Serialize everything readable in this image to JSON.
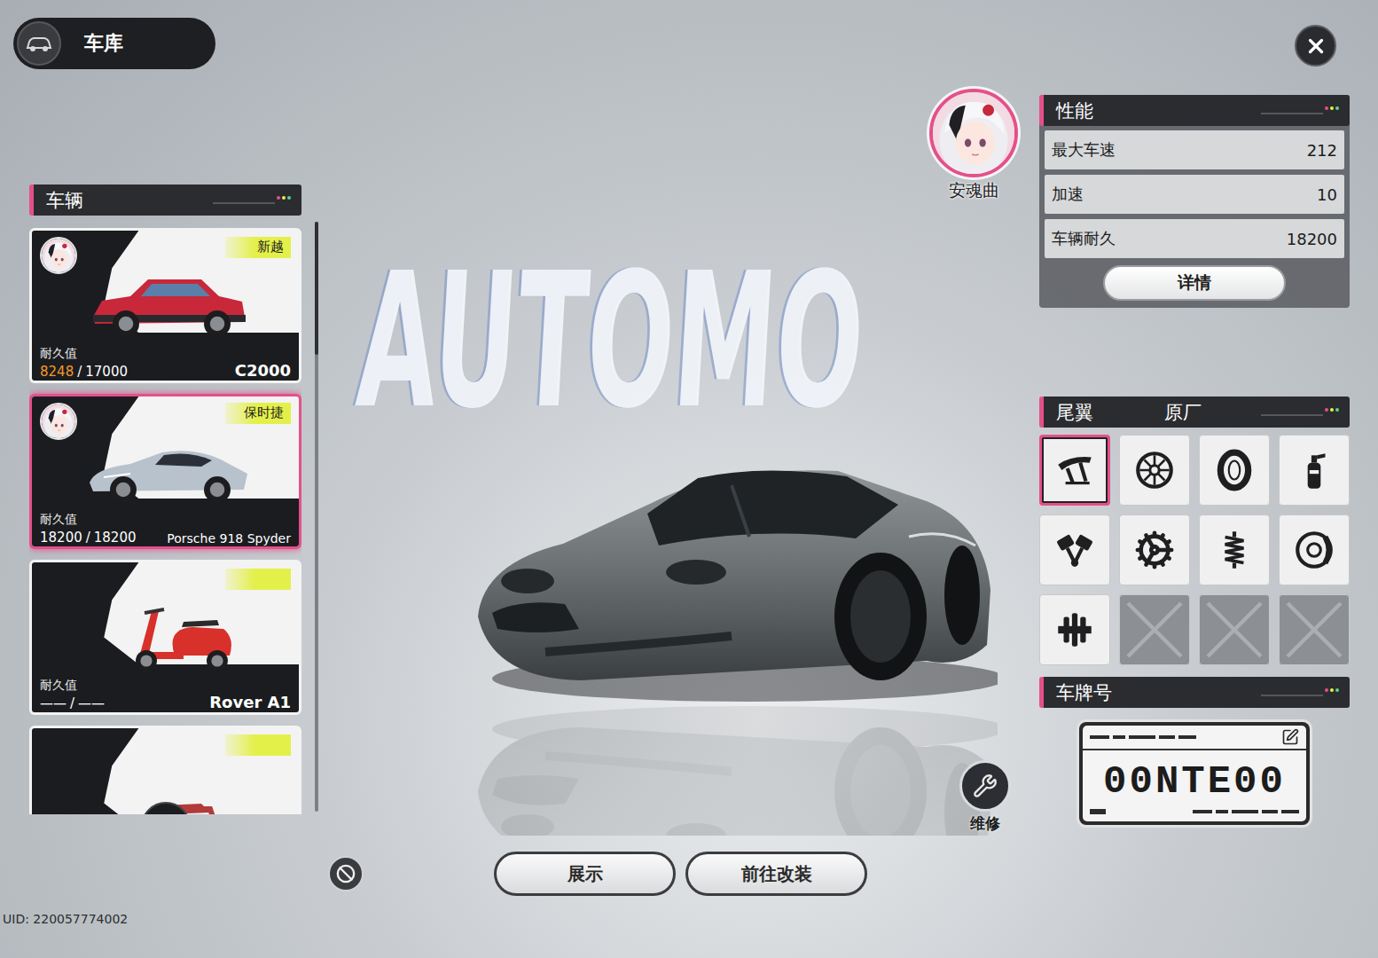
{
  "header": {
    "title": "车库"
  },
  "backdrop": {
    "text": "AUTOMO"
  },
  "vehicles_panel": {
    "title": "车辆",
    "durability_label": "耐久值",
    "durability_separator": "/"
  },
  "vehicles": [
    {
      "name": "C2000",
      "brand": "新越",
      "durability_current": "8248",
      "durability_max": "17000",
      "damaged": true,
      "locked": false,
      "selected": false,
      "has_driver": true,
      "kind": "sedan",
      "color": "#c8283a"
    },
    {
      "name": "Porsche 918 Spyder",
      "brand": "保时捷",
      "durability_current": "18200",
      "durability_max": "18200",
      "damaged": false,
      "locked": false,
      "selected": true,
      "has_driver": true,
      "kind": "supercar",
      "color": "#b7c2cc"
    },
    {
      "name": "Rover A1",
      "brand": "",
      "durability_current": "——",
      "durability_max": "——",
      "damaged": false,
      "locked": false,
      "selected": false,
      "has_driver": false,
      "kind": "scooter",
      "color": "#d8302a"
    },
    {
      "name": "",
      "brand": "",
      "durability_current": "",
      "durability_max": "",
      "damaged": false,
      "locked": true,
      "selected": false,
      "has_driver": false,
      "kind": "motorbike",
      "color": "#b23a3a"
    }
  ],
  "driver": {
    "name": "安魂曲"
  },
  "performance": {
    "title": "性能",
    "stats": [
      {
        "label": "最大车速",
        "value": "212"
      },
      {
        "label": "加速",
        "value": "10"
      },
      {
        "label": "车辆耐久",
        "value": "18200"
      }
    ],
    "details_button": "详情"
  },
  "parts": {
    "title": "尾翼",
    "value": "原厂",
    "slots": [
      {
        "kind": "wing",
        "selected": true
      },
      {
        "kind": "rim",
        "selected": false
      },
      {
        "kind": "tire",
        "selected": false
      },
      {
        "kind": "nitro",
        "selected": false
      },
      {
        "kind": "piston",
        "selected": false
      },
      {
        "kind": "gear",
        "selected": false
      },
      {
        "kind": "spring",
        "selected": false
      },
      {
        "kind": "brake",
        "selected": false
      },
      {
        "kind": "clutch",
        "selected": false
      },
      {
        "kind": "empty",
        "selected": false
      },
      {
        "kind": "empty",
        "selected": false
      },
      {
        "kind": "empty",
        "selected": false
      }
    ]
  },
  "plate": {
    "title": "车牌号",
    "number": "00NTE00"
  },
  "repair_button": "维修",
  "actions": [
    {
      "label": "展示"
    },
    {
      "label": "前往改装"
    }
  ],
  "uid": "UID: 220057774002"
}
